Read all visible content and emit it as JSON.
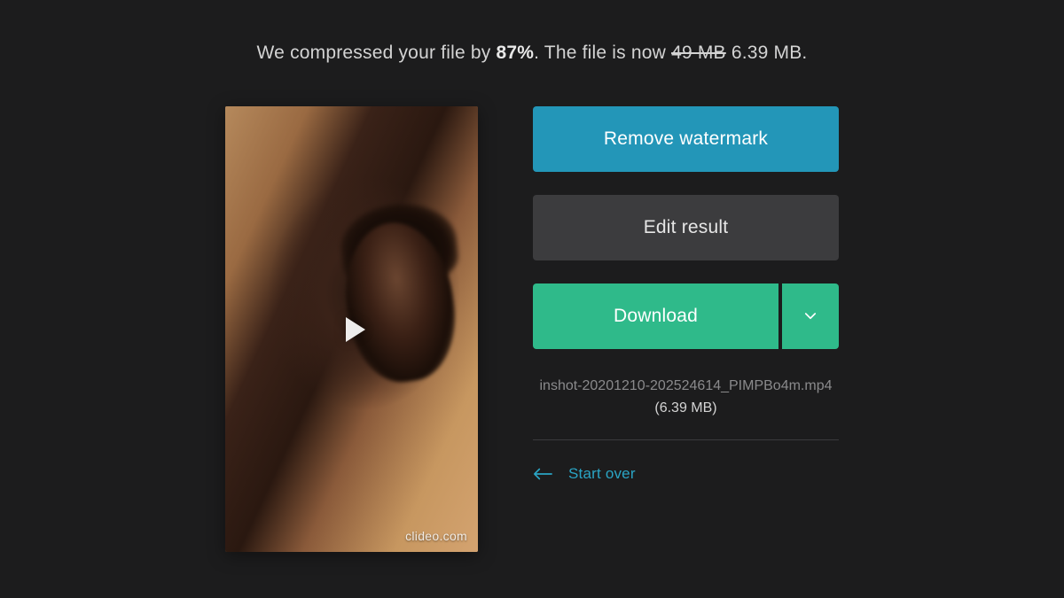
{
  "status": {
    "prefix": "We compressed your file by ",
    "percent": "87%",
    "mid": ". The file is now ",
    "old_size": "49 MB",
    "new_size": "6.39 MB",
    "suffix": "."
  },
  "video": {
    "watermark": "clideo.com"
  },
  "actions": {
    "remove_watermark": "Remove watermark",
    "edit_result": "Edit result",
    "download": "Download"
  },
  "file": {
    "name": "inshot-20201210-202524614_PIMPBo4m.mp4",
    "size": "(6.39 MB)"
  },
  "start_over": "Start over"
}
